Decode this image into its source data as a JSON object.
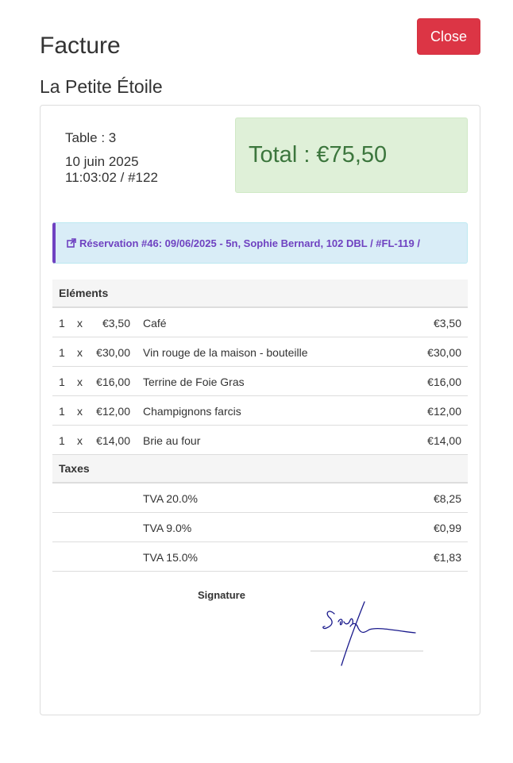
{
  "header": {
    "title": "Facture",
    "close_label": "Close",
    "restaurant": "La Petite Étoile"
  },
  "invoice": {
    "table_label": "Table : 3",
    "date": "10 juin 2025",
    "time_ref": "11:03:02 / #122",
    "total_label": "Total : €75,50"
  },
  "reservation": {
    "icon": "external-link-icon",
    "text": "Réservation #46: 09/06/2025 - 5n, Sophie Bernard, 102 DBL / #FL-119 /"
  },
  "items": {
    "header": "Eléments",
    "rows": [
      {
        "qty": "1",
        "x": "x",
        "unit": "€3,50",
        "name": "Café",
        "total": "€3,50"
      },
      {
        "qty": "1",
        "x": "x",
        "unit": "€30,00",
        "name": "Vin rouge de la maison - bouteille",
        "total": "€30,00"
      },
      {
        "qty": "1",
        "x": "x",
        "unit": "€16,00",
        "name": "Terrine de Foie Gras",
        "total": "€16,00"
      },
      {
        "qty": "1",
        "x": "x",
        "unit": "€12,00",
        "name": "Champignons farcis",
        "total": "€12,00"
      },
      {
        "qty": "1",
        "x": "x",
        "unit": "€14,00",
        "name": "Brie au four",
        "total": "€14,00"
      }
    ]
  },
  "taxes": {
    "header": "Taxes",
    "rows": [
      {
        "name": "TVA 20.0%",
        "total": "€8,25"
      },
      {
        "name": "TVA 9.0%",
        "total": "€0,99"
      },
      {
        "name": "TVA 15.0%",
        "total": "€1,83"
      }
    ]
  },
  "signature": {
    "label": "Signature"
  },
  "colors": {
    "close_button": "#dc3545",
    "total_text": "#3c763d",
    "total_bg": "#dff0d8",
    "reservation_text": "#6f42c1",
    "reservation_bg": "#d9edf7",
    "signature_ink": "#1a1a8c"
  }
}
